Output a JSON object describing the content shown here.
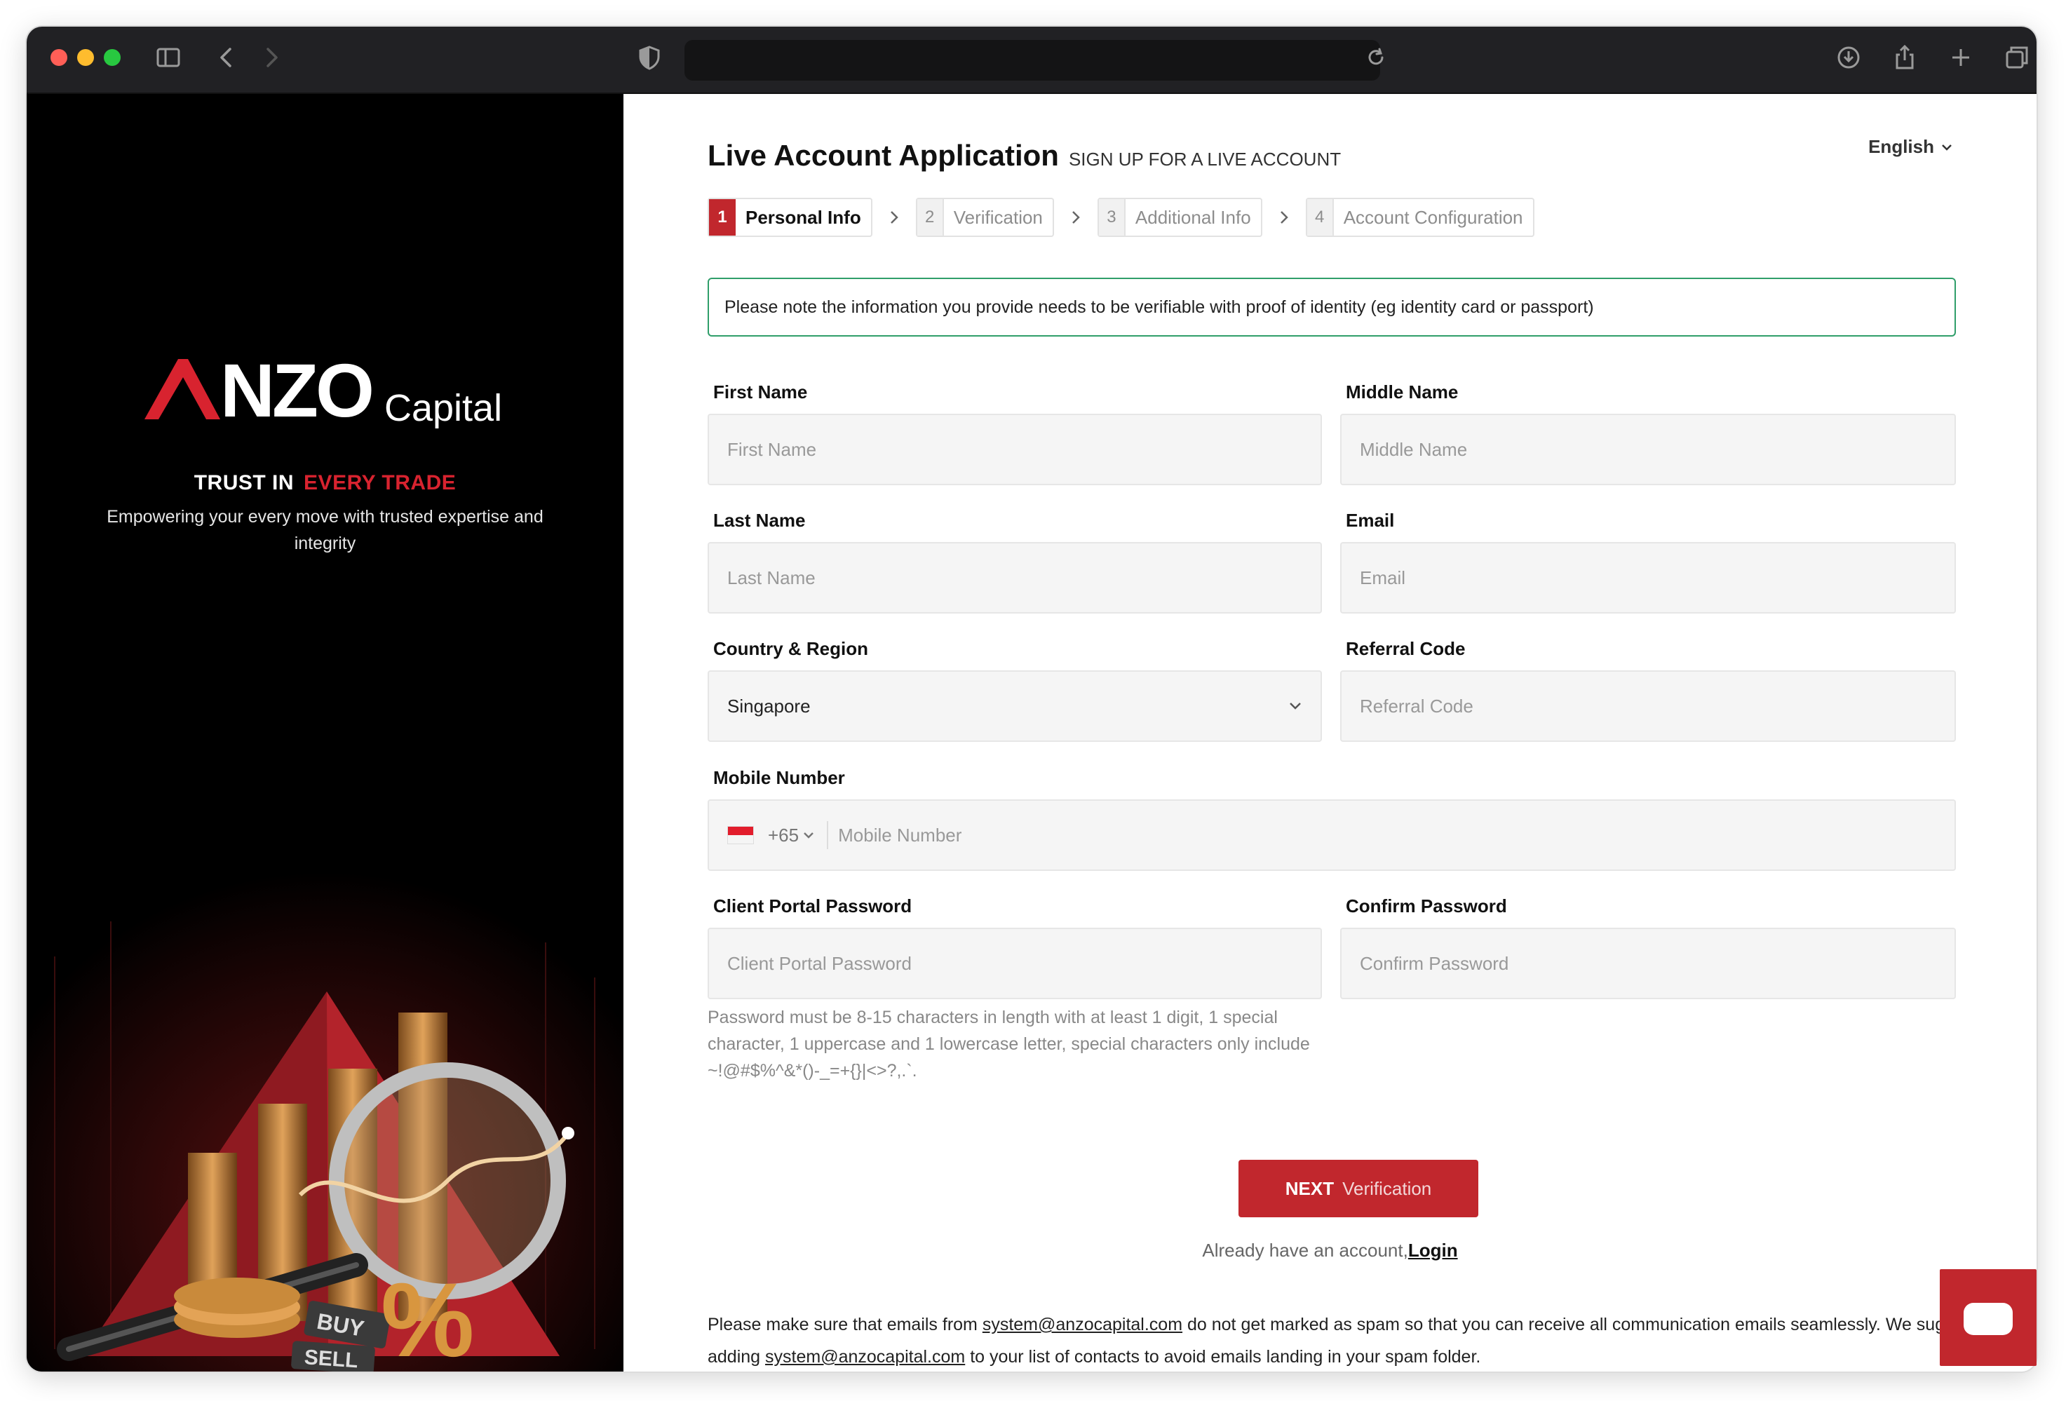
{
  "browser": {
    "icons": [
      "sidebar-icon",
      "back-icon",
      "forward-icon",
      "shield-icon",
      "reload-icon",
      "download-icon",
      "share-icon",
      "new-tab-icon",
      "tabs-overview-icon"
    ]
  },
  "hero": {
    "brand": "Capital",
    "tagline_part1": "TRUST IN",
    "tagline_part2": "EVERY TRADE",
    "subtitle": "Empowering your every move with trusted expertise and integrity",
    "art_labels": {
      "buy": "BUY",
      "sell": "SELL",
      "percent": "%"
    },
    "accent_color": "#d8232f"
  },
  "form": {
    "language": "English",
    "title": "Live Account Application",
    "subtitle": "SIGN UP FOR A LIVE ACCOUNT",
    "steps": [
      {
        "num": "1",
        "label": "Personal Info"
      },
      {
        "num": "2",
        "label": "Verification"
      },
      {
        "num": "3",
        "label": "Additional Info"
      },
      {
        "num": "4",
        "label": "Account Configuration"
      }
    ],
    "note": "Please note the information you provide needs to be verifiable with proof of identity (eg identity card or passport)",
    "fields": {
      "first_name": {
        "label": "First Name",
        "placeholder": "First Name"
      },
      "middle_name": {
        "label": "Middle Name",
        "placeholder": "Middle Name"
      },
      "last_name": {
        "label": "Last Name",
        "placeholder": "Last Name"
      },
      "email": {
        "label": "Email",
        "placeholder": "Email"
      },
      "country": {
        "label": "Country & Region",
        "value": "Singapore"
      },
      "referral": {
        "label": "Referral Code",
        "placeholder": "Referral Code"
      },
      "mobile": {
        "label": "Mobile Number",
        "code": "+65",
        "placeholder": "Mobile Number"
      },
      "password": {
        "label": "Client Portal Password",
        "placeholder": "Client Portal Password"
      },
      "confirm": {
        "label": "Confirm Password",
        "placeholder": "Confirm Password"
      }
    },
    "password_hint": "Password must be 8-15 characters in length with at least 1 digit, 1 special character, 1 uppercase and 1 lowercase letter, special characters only include ~!@#$%^&*()-_=+{}|<>?,.`.",
    "next_button": {
      "strong": "NEXT",
      "step": "Verification"
    },
    "login_prompt": "Already have an account,",
    "login_link": "Login",
    "footer": {
      "part1": "Please make sure that emails from ",
      "email": "system@anzocapital.com",
      "part2": " do not get marked as spam so that you can receive all communication emails seamlessly. We suggest adding ",
      "part3": " to your list of contacts to avoid emails landing in your spam folder."
    },
    "accent_color": "#c1272d"
  }
}
